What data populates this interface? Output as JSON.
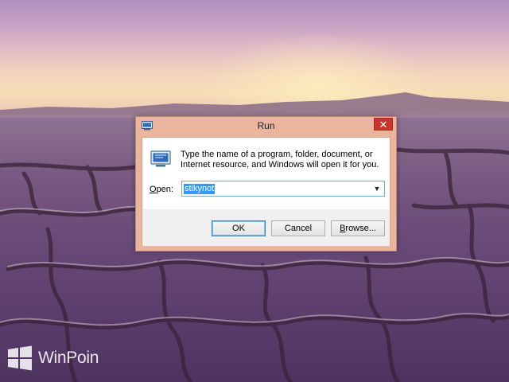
{
  "dialog": {
    "title": "Run",
    "close_glyph": "✕",
    "description": "Type the name of a program, folder, document, or Internet resource, and Windows will open it for you.",
    "open_label_accel": "O",
    "open_label_rest": "pen:",
    "open_value": "stikynot",
    "dropdown_glyph": "▼",
    "buttons": {
      "ok": "OK",
      "cancel": "Cancel",
      "browse_accel": "B",
      "browse_rest": "rowse..."
    }
  },
  "watermark": {
    "text": "WinPoin"
  },
  "icons": [
    "run-icon",
    "close-icon",
    "chevron-down-icon",
    "windows-logo-icon"
  ],
  "colors": {
    "frame": "#e9b59c",
    "close": "#c7362b",
    "selection": "#3399ff",
    "focus_border": "#7aa7d6"
  }
}
